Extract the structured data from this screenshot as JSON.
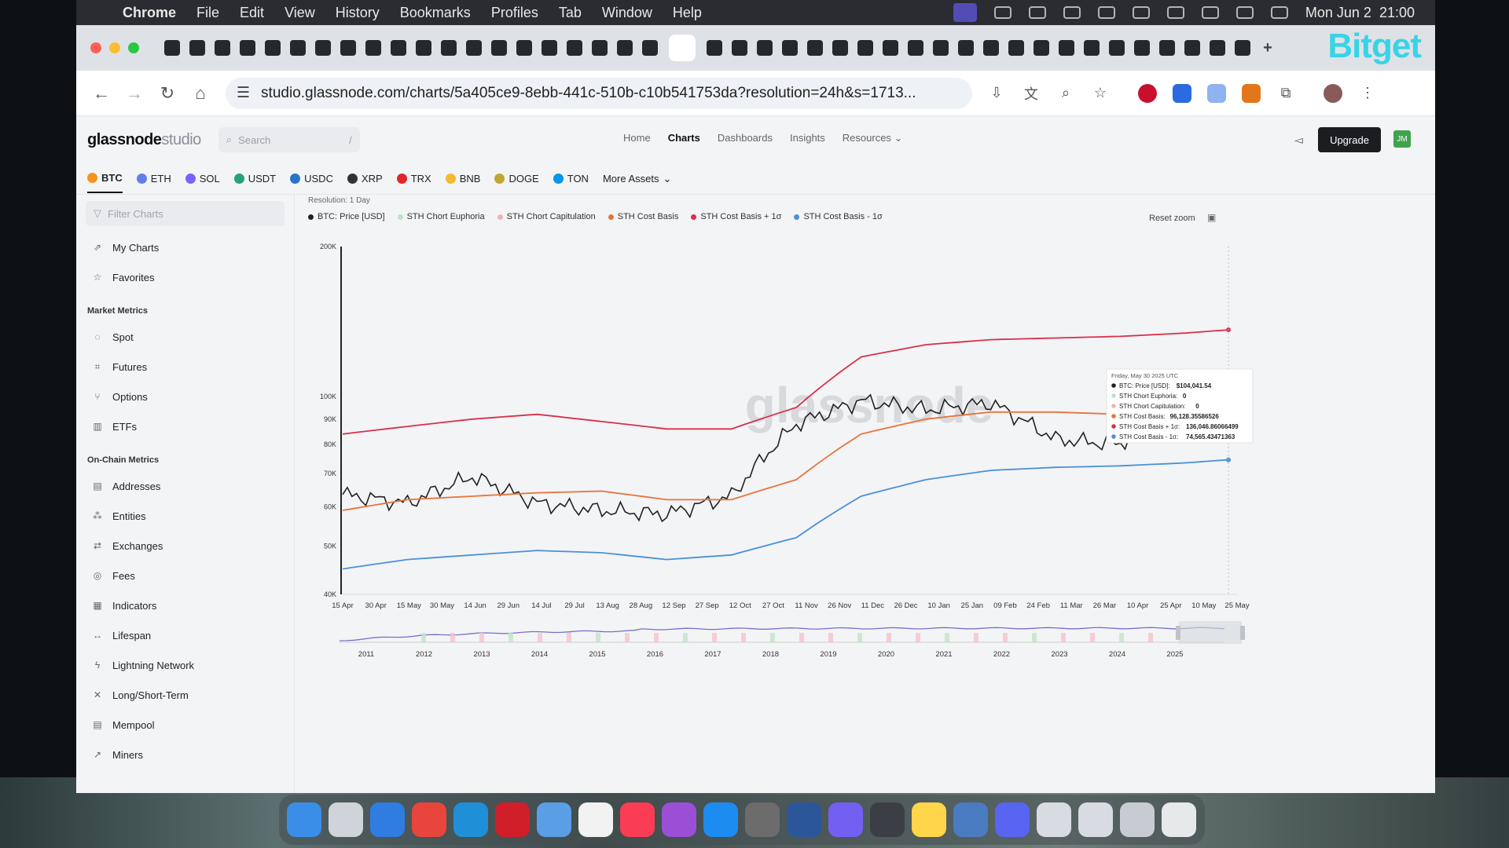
{
  "menubar": {
    "app_name": "Chrome",
    "items": [
      "File",
      "Edit",
      "View",
      "History",
      "Bookmarks",
      "Profiles",
      "Tab",
      "Window",
      "Help"
    ],
    "clock": "Mon Jun 2  21:00"
  },
  "browser": {
    "url": "studio.glassnode.com/charts/5a405ce9-8ebb-441c-510b-c10b541753da?resolution=24h&s=1713...",
    "bitget_label": "Bitget"
  },
  "app": {
    "logo_main": "glassnode",
    "logo_sub": "studio",
    "search_placeholder": "Search",
    "search_shortcut": "/",
    "nav": [
      "Home",
      "Charts",
      "Dashboards",
      "Insights",
      "Resources"
    ],
    "upgrade_label": "Upgrade",
    "avatar_initials": "JM"
  },
  "assets": [
    {
      "label": "BTC",
      "color": "#f7931a"
    },
    {
      "label": "ETH",
      "color": "#627eea"
    },
    {
      "label": "SOL",
      "color": "#7b61ff"
    },
    {
      "label": "USDT",
      "color": "#26a17b"
    },
    {
      "label": "USDC",
      "color": "#2775ca"
    },
    {
      "label": "XRP",
      "color": "#333333"
    },
    {
      "label": "TRX",
      "color": "#e0262b"
    },
    {
      "label": "BNB",
      "color": "#f3ba2f"
    },
    {
      "label": "DOGE",
      "color": "#c2a633"
    },
    {
      "label": "TON",
      "color": "#0098ea"
    },
    {
      "label": "More Assets",
      "color": ""
    }
  ],
  "sidebar": {
    "filter_placeholder": "Filter Charts",
    "top_items": [
      "My Charts",
      "Favorites"
    ],
    "market_heading": "Market Metrics",
    "market_items": [
      "Spot",
      "Futures",
      "Options",
      "ETFs"
    ],
    "onchain_heading": "On-Chain Metrics",
    "onchain_items": [
      "Addresses",
      "Entities",
      "Exchanges",
      "Fees",
      "Indicators",
      "Lifespan",
      "Lightning Network",
      "Long/Short-Term",
      "Mempool",
      "Miners"
    ]
  },
  "chart_controls": {
    "resolution_label": "Resolution: 1 Day",
    "reset_zoom": "Reset zoom"
  },
  "chart_data": {
    "type": "line",
    "watermark": "glassnode",
    "y_scale": "log",
    "ylim": [
      40000,
      200000
    ],
    "y_ticks": [
      "200K",
      "100K",
      "90K",
      "80K",
      "70K",
      "60K",
      "50K",
      "40K"
    ],
    "x_ticks": [
      "15 Apr",
      "30 Apr",
      "15 May",
      "30 May",
      "14 Jun",
      "29 Jun",
      "14 Jul",
      "29 Jul",
      "13 Aug",
      "28 Aug",
      "12 Sep",
      "27 Sep",
      "12 Oct",
      "27 Oct",
      "11 Nov",
      "26 Nov",
      "11 Dec",
      "26 Dec",
      "10 Jan",
      "25 Jan",
      "09 Feb",
      "24 Feb",
      "11 Mar",
      "26 Mar",
      "10 Apr",
      "25 Apr",
      "10 May",
      "25 May"
    ],
    "navigator_years": [
      "2011",
      "2012",
      "2013",
      "2014",
      "2015",
      "2016",
      "2017",
      "2018",
      "2019",
      "2020",
      "2021",
      "2022",
      "2023",
      "2024",
      "2025"
    ],
    "x_dates": [
      "2024-04-15",
      "2024-05-15",
      "2024-06-14",
      "2024-07-14",
      "2024-08-13",
      "2024-09-12",
      "2024-10-12",
      "2024-11-11",
      "2024-12-11",
      "2025-01-10",
      "2025-02-09",
      "2025-03-11",
      "2025-04-10",
      "2025-05-10",
      "2025-05-30"
    ],
    "series": [
      {
        "name": "BTC: Price [USD]",
        "color": "#222222",
        "values": [
          63500,
          61000,
          69000,
          61000,
          59000,
          58000,
          63000,
          88000,
          98000,
          94000,
          97000,
          82000,
          80000,
          104000,
          104041
        ]
      },
      {
        "name": "STH Chort Euphoria",
        "color": "#b9e3c6",
        "values": []
      },
      {
        "name": "STH Chort Capitulation",
        "color": "#f3b1b9",
        "values": []
      },
      {
        "name": "STH Cost Basis",
        "color": "#e8743a",
        "values": [
          59000,
          62000,
          63000,
          64000,
          64500,
          62000,
          62000,
          68000,
          84000,
          90000,
          93000,
          93000,
          92000,
          93000,
          96128
        ]
      },
      {
        "name": "STH Cost Basis + 1σ",
        "color": "#d9304a",
        "values": [
          84000,
          87000,
          90000,
          92000,
          89000,
          86000,
          86000,
          95000,
          120000,
          127000,
          130000,
          131000,
          132000,
          134000,
          136046
        ]
      },
      {
        "name": "STH Cost Basis - 1σ",
        "color": "#4a90d9",
        "values": [
          45000,
          47000,
          48000,
          49000,
          48500,
          47000,
          48000,
          52000,
          63000,
          68000,
          71000,
          72000,
          72500,
          73500,
          74565
        ]
      }
    ],
    "tooltip": {
      "date": "Friday, May 30 2025 UTC",
      "rows": [
        {
          "label": "BTC: Price [USD]:",
          "value": "$104,041.54",
          "color": "#222222"
        },
        {
          "label": "STH Chort Euphoria:",
          "value": "0",
          "color": "#b9e3c6"
        },
        {
          "label": "STH Chort Capitulation:",
          "value": "0",
          "color": "#f3b1b9"
        },
        {
          "label": "STH Cost Basis:",
          "value": "96,128.35586526",
          "color": "#e8743a"
        },
        {
          "label": "STH Cost Basis + 1σ:",
          "value": "136,046.86066499",
          "color": "#d9304a"
        },
        {
          "label": "STH Cost Basis - 1σ:",
          "value": "74,565.43471363",
          "color": "#4a90d9"
        }
      ]
    }
  }
}
